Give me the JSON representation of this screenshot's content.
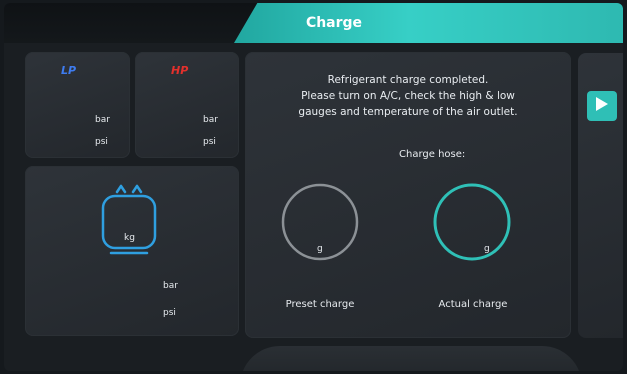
{
  "header": {
    "title": "Charge"
  },
  "pressure": {
    "lp": {
      "label": "LP",
      "unit_bar": "bar",
      "unit_psi": "psi"
    },
    "hp": {
      "label": "HP",
      "unit_bar": "bar",
      "unit_psi": "psi"
    }
  },
  "tank": {
    "unit_kg": "kg",
    "unit_bar": "bar",
    "unit_psi": "psi"
  },
  "message": {
    "line1": "Refrigerant charge completed.",
    "line2": "Please turn on A/C, check the high & low",
    "line3": "gauges and temperature of the air outlet.",
    "hose_label": "Charge hose:"
  },
  "dials": {
    "preset": {
      "unit": "g",
      "label": "Preset charge",
      "color": "#8c9196"
    },
    "actual": {
      "unit": "g",
      "label": "Actual charge",
      "color": "#2fc0b7"
    }
  },
  "colors": {
    "accent": "#2fbfb6",
    "lp": "#3e7cf0",
    "hp": "#e3302c"
  },
  "icons": {
    "next": "play-icon",
    "tank": "refrigerant-tank-icon"
  }
}
